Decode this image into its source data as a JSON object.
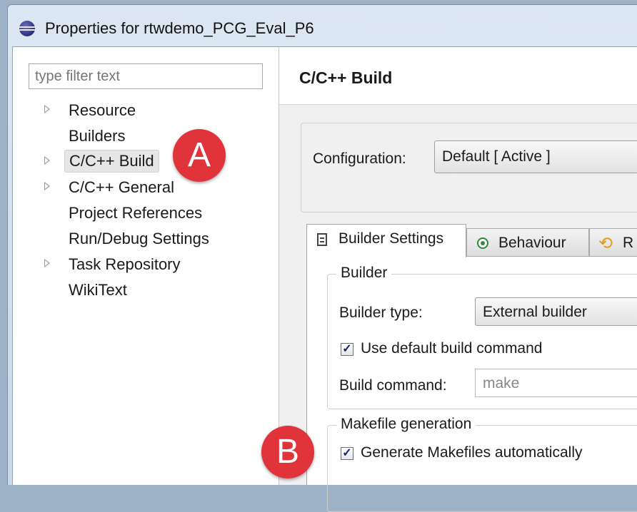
{
  "window": {
    "title": "Properties for rtwdemo_PCG_Eval_P6"
  },
  "left_pane": {
    "filter_placeholder": "type filter text",
    "tree": [
      {
        "label": "Resource",
        "expandable": true
      },
      {
        "label": "Builders",
        "expandable": false
      },
      {
        "label": "C/C++ Build",
        "expandable": true,
        "selected": true
      },
      {
        "label": "C/C++ General",
        "expandable": true
      },
      {
        "label": "Project References",
        "expandable": false
      },
      {
        "label": "Run/Debug Settings",
        "expandable": false
      },
      {
        "label": "Task Repository",
        "expandable": true
      },
      {
        "label": "WikiText",
        "expandable": false
      }
    ]
  },
  "right_pane": {
    "page_title": "C/C++ Build",
    "configuration": {
      "label": "Configuration:",
      "value": "Default  [ Active ]"
    },
    "tabs": [
      {
        "label": "Builder Settings",
        "icon": "list-icon",
        "active": true
      },
      {
        "label": "Behaviour",
        "icon": "radio-icon",
        "active": false
      },
      {
        "label": "R",
        "icon": "refresh-icon",
        "active": false
      }
    ],
    "builder_group": {
      "legend": "Builder",
      "builder_type_label": "Builder type:",
      "builder_type_value": "External builder",
      "use_default_label": "Use default build command",
      "use_default_checked": true,
      "build_command_label": "Build command:",
      "build_command_value": "make"
    },
    "makefile_group": {
      "legend": "Makefile generation",
      "generate_label": "Generate Makefiles automatically",
      "generate_checked": true
    }
  },
  "callouts": {
    "a": "A",
    "b": "B"
  },
  "colors": {
    "callout": "#e0343a",
    "title_bar": "#dce7f3"
  }
}
